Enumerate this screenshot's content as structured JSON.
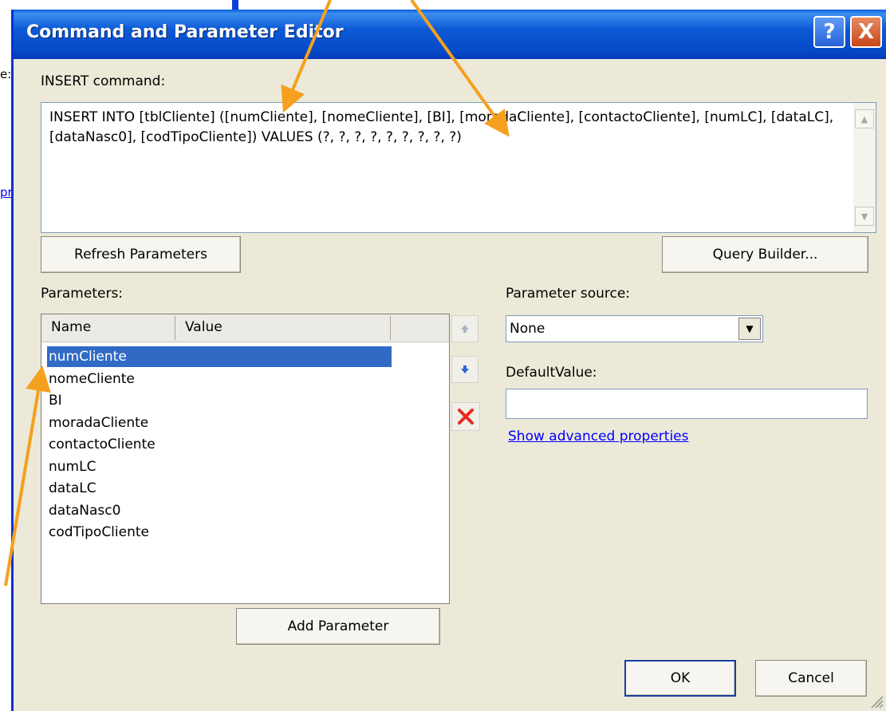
{
  "background": {
    "fragments": [
      "e:",
      "pr"
    ]
  },
  "dialog": {
    "title": "Command and Parameter Editor",
    "help_symbol": "?",
    "close_symbol": "X",
    "command_label": "INSERT command:",
    "command_text": "INSERT INTO [tblCliente] ([numCliente], [nomeCliente], [BI], [moradaCliente], [contactoCliente], [numLC], [dataLC], [dataNasc0], [codTipoCliente]) VALUES (?, ?, ?, ?, ?, ?, ?, ?, ?)",
    "refresh_button": "Refresh Parameters",
    "query_builder_button": "Query Builder...",
    "parameters_label": "Parameters:",
    "parameters_columns": [
      "Name",
      "Value"
    ],
    "parameters": [
      {
        "name": "numCliente",
        "value": ""
      },
      {
        "name": "nomeCliente",
        "value": ""
      },
      {
        "name": "BI",
        "value": ""
      },
      {
        "name": "moradaCliente",
        "value": ""
      },
      {
        "name": "contactoCliente",
        "value": ""
      },
      {
        "name": "numLC",
        "value": ""
      },
      {
        "name": "dataLC",
        "value": ""
      },
      {
        "name": "dataNasc0",
        "value": ""
      },
      {
        "name": "codTipoCliente",
        "value": ""
      }
    ],
    "selected_parameter": "numCliente",
    "parameter_source_label": "Parameter source:",
    "parameter_source_value": "None",
    "default_value_label": "DefaultValue:",
    "default_value": "",
    "advanced_link": "Show advanced properties",
    "add_parameter_button": "Add Parameter",
    "ok_button": "OK",
    "cancel_button": "Cancel"
  },
  "colors": {
    "title_blue": "#0449c8",
    "selection": "#316ac5",
    "annotation_arrow": "#f5a01e",
    "link": "#0000ff"
  }
}
